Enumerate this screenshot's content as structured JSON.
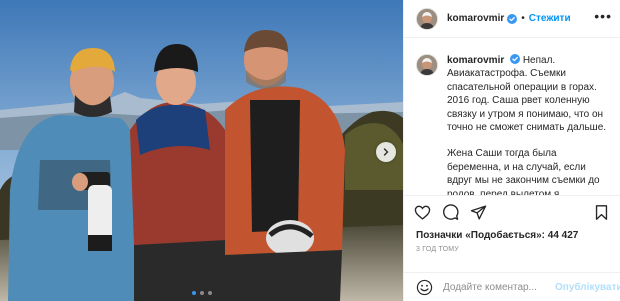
{
  "post": {
    "username": "komarovmir",
    "follow_label": "Стежити",
    "caption": {
      "paragraph1": "Непал. Авиакатастрофа. Съемки спасательной операции в горах. 2016 год. Саша рвет коленную связку и утром я понимаю, что он точно не сможет снимать дальше.",
      "paragraph2": "Жена Саши тогда была беременна, и на случай, если вдруг мы не закончим съемки до родов, перед вылетом я познакомился с оператором Сашей Шиловым. Мы не договаривались о"
    },
    "likes_label": "Позначки «Подобається»: 44 427",
    "time_label": "3 ГОД ТОМУ",
    "comment_placeholder": "Додайте коментар...",
    "publish_label": "Опублікувати"
  },
  "icons": {
    "verified": "verified-badge-icon",
    "more": "more-options-icon",
    "like": "heart-icon",
    "comment": "comment-icon",
    "share": "share-icon",
    "save": "bookmark-icon",
    "emoji": "emoji-icon",
    "next": "chevron-right-icon"
  },
  "colors": {
    "accent": "#0095f6",
    "verified": "#3897f0",
    "publish_disabled": "#b2dffc",
    "muted": "#8e8e8e"
  }
}
